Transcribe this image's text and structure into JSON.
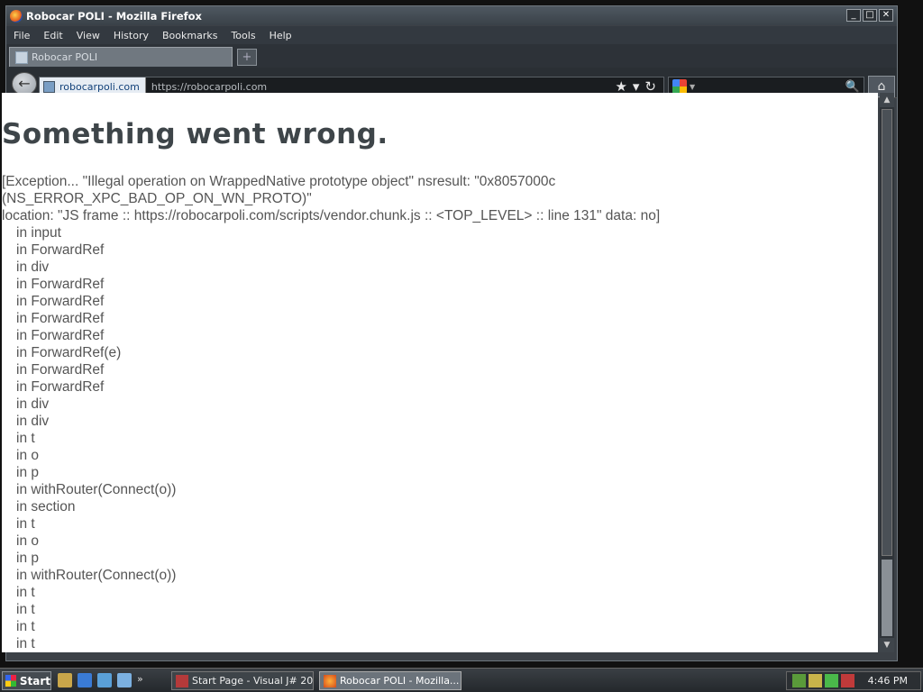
{
  "window": {
    "title": "Robocar POLI - Mozilla Firefox",
    "controls": {
      "minimize": "_",
      "maximize": "□",
      "close": "✕"
    }
  },
  "menu": [
    "File",
    "Edit",
    "View",
    "History",
    "Bookmarks",
    "Tools",
    "Help"
  ],
  "tab": {
    "label": "Robocar POLI",
    "new_tab": "+"
  },
  "navbar": {
    "back": "←",
    "identity": "robocarpoli.com",
    "url": "https://robocarpoli.com",
    "star": "★",
    "dropdown": "▾",
    "reload": "↻",
    "search_value": "",
    "search_go": "🔍",
    "home": "⌂"
  },
  "page": {
    "heading": "Something went wrong.",
    "error_line1": "[Exception... \"Illegal operation on WrappedNative prototype object\"  nsresult: \"0x8057000c (NS_ERROR_XPC_BAD_OP_ON_WN_PROTO)\"",
    "error_line2": "location: \"JS frame :: https://robocarpoli.com/scripts/vendor.chunk.js :: <TOP_LEVEL> :: line 131\"  data: no]",
    "stack": [
      "in input",
      "in ForwardRef",
      "in div",
      "in ForwardRef",
      "in ForwardRef",
      "in ForwardRef",
      "in ForwardRef",
      "in ForwardRef(e)",
      "in ForwardRef",
      "in ForwardRef",
      "in div",
      "in div",
      "in t",
      "in o",
      "in p",
      "in withRouter(Connect(o))",
      "in section",
      "in t",
      "in o",
      "in p",
      "in withRouter(Connect(o))",
      "in t",
      "in t",
      "in t",
      "in t"
    ]
  },
  "taskbar": {
    "start": "Start",
    "more": "»",
    "tasks": [
      {
        "label": "Start Page - Visual J# 20...",
        "active": false
      },
      {
        "label": "Robocar POLI - Mozilla...",
        "active": true
      }
    ],
    "clock": "4:46 PM"
  },
  "colors": {
    "chrome": "#3c4147",
    "page_bg": "#ffffff",
    "heading": "#3e4549",
    "text": "#555555"
  }
}
